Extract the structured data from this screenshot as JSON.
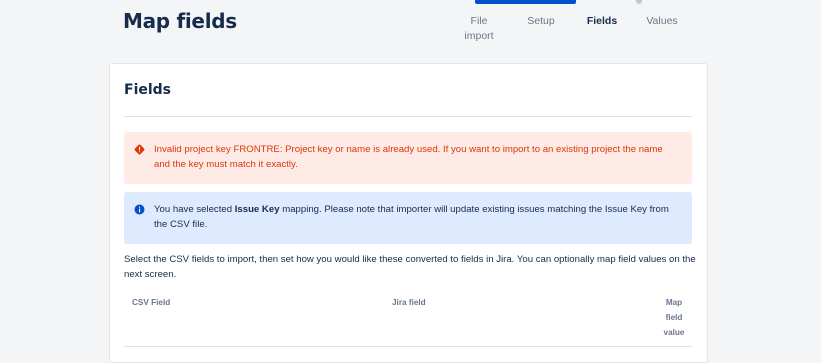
{
  "header": {
    "title": "Map fields"
  },
  "steps": [
    {
      "label_line1": "File",
      "label_line2": "import",
      "active": false
    },
    {
      "label_line1": "Setup",
      "label_line2": "",
      "active": false
    },
    {
      "label_line1": "Fields",
      "label_line2": "",
      "active": true
    },
    {
      "label_line1": "Values",
      "label_line2": "",
      "active": false
    }
  ],
  "card": {
    "title": "Fields",
    "error_alert": {
      "icon": "error-icon",
      "text": "Invalid project key FRONTRE: Project key or name is already used. If you want to import to an existing project the name and the key must match it exactly."
    },
    "info_alert": {
      "icon": "info-icon",
      "text_before": "You have selected ",
      "text_bold": "Issue Key",
      "text_after": " mapping. Please note that importer will update existing issues matching the Issue Key from the CSV file."
    },
    "description": "Select the CSV fields to import, then set how you would like these converted to fields in Jira. You can optionally map field values on the next screen.",
    "table": {
      "columns": [
        "CSV Field",
        "Jira field",
        "Map field value"
      ]
    }
  },
  "colors": {
    "progress": "#0052cc",
    "error_bg": "#ffebe6",
    "error_text": "#de350b",
    "info_bg": "#deebff",
    "info_icon": "#0052cc"
  }
}
